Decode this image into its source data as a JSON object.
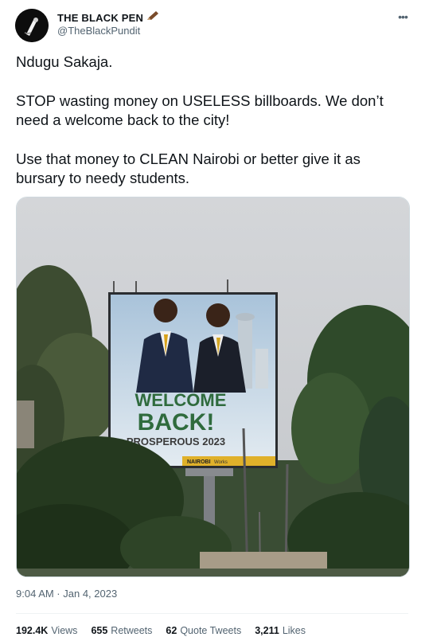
{
  "author": {
    "display_name": "THE BLACK PEN",
    "handle": "@TheBlackPundit"
  },
  "tweet": {
    "paragraphs": [
      "Ndugu Sakaja.",
      "STOP wasting money on USELESS billboards. We don’t need a welcome back to the city!",
      "Use that money to CLEAN Nairobi or better give it as bursary to needy students."
    ],
    "timestamp": "9:04 AM · Jan 4, 2023"
  },
  "photo": {
    "billboard_line1": "WELCOME",
    "billboard_line2": "BACK!",
    "billboard_line3": "PROSPEROUS 2023",
    "billboard_footer": "NAIROBI",
    "billboard_footer_small": "Works"
  },
  "stats": {
    "views_count": "192.4K",
    "views_label": "Views",
    "retweets_count": "655",
    "retweets_label": "Retweets",
    "quotes_count": "62",
    "quotes_label": "Quote Tweets",
    "likes_count": "3,211",
    "likes_label": "Likes"
  },
  "icons": {
    "verified": "pen-emoji-icon",
    "more": "more-icon"
  },
  "colors": {
    "text": "#0f1419",
    "secondary": "#536471",
    "billboard_green": "#2f6b3d"
  }
}
